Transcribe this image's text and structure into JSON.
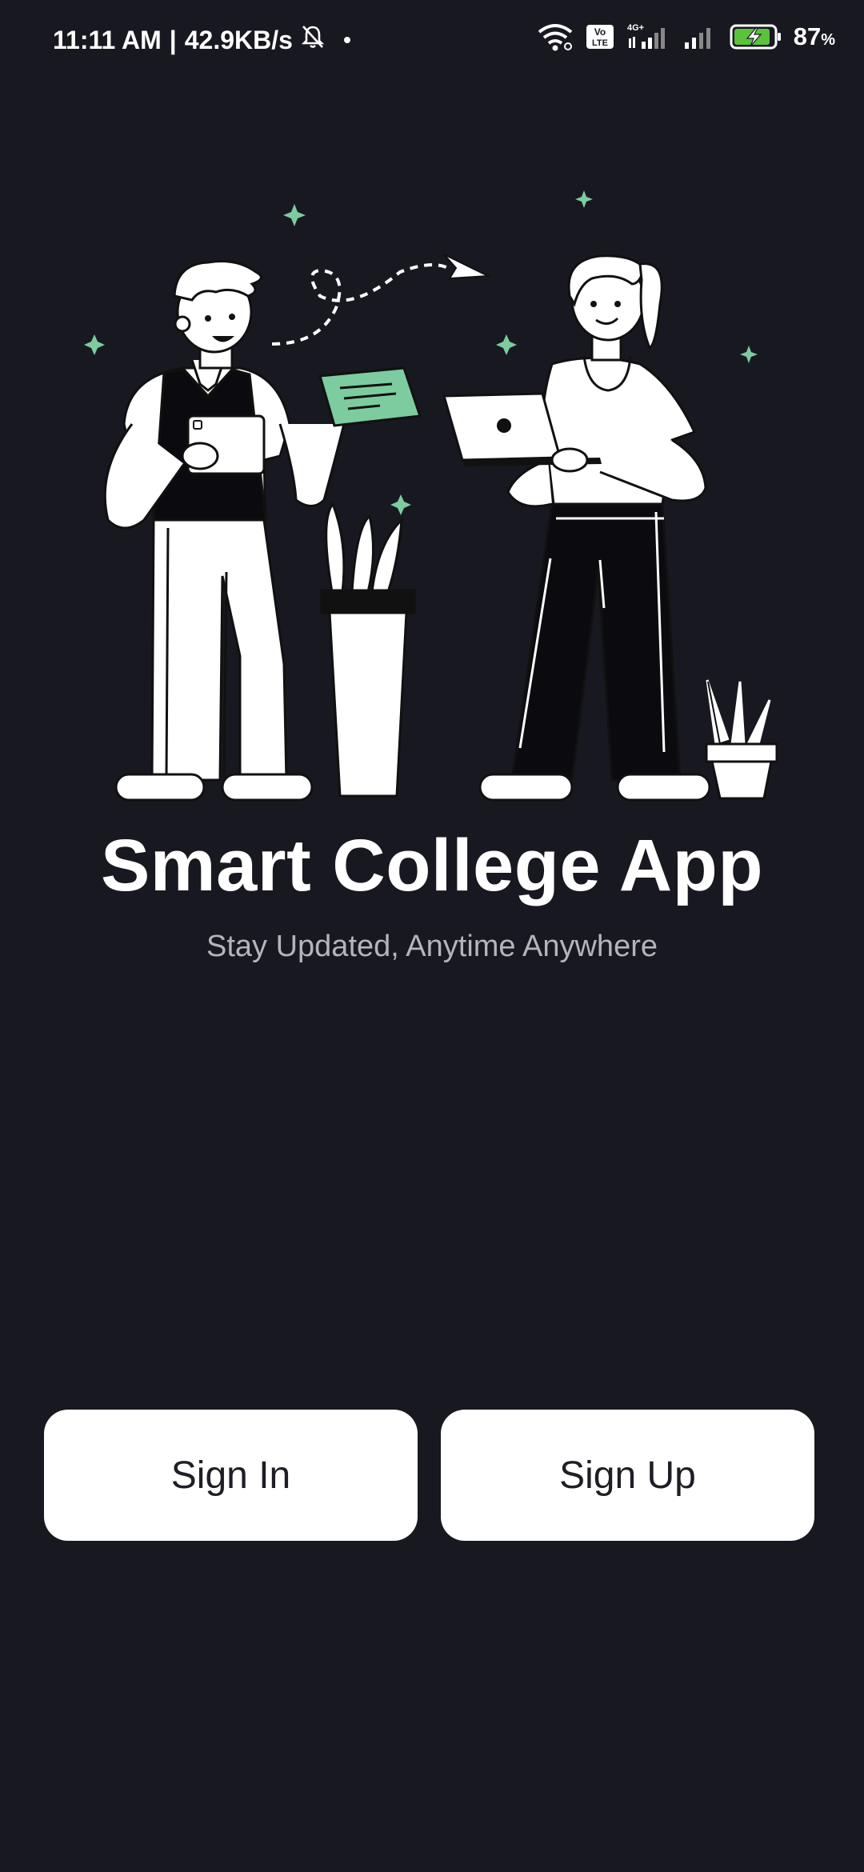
{
  "status_bar": {
    "time": "11:11 AM",
    "separator": "|",
    "net_speed": "42.9KB/s",
    "volte": "Vo LTE",
    "network_type": "4G+",
    "battery_percent": "87",
    "battery_unit": "%",
    "battery_level": 0.87
  },
  "illustration": {
    "description_icon": "two-people-sharing-illustration",
    "accent_color": "#7ccc9f"
  },
  "hero": {
    "title": "Smart College App",
    "subtitle": "Stay Updated, Anytime Anywhere"
  },
  "actions": {
    "sign_in": "Sign In",
    "sign_up": "Sign Up"
  },
  "colors": {
    "background": "#181820",
    "button_bg": "#ffffff",
    "button_text": "#1e1e24",
    "subtitle": "#b4b4ba"
  }
}
